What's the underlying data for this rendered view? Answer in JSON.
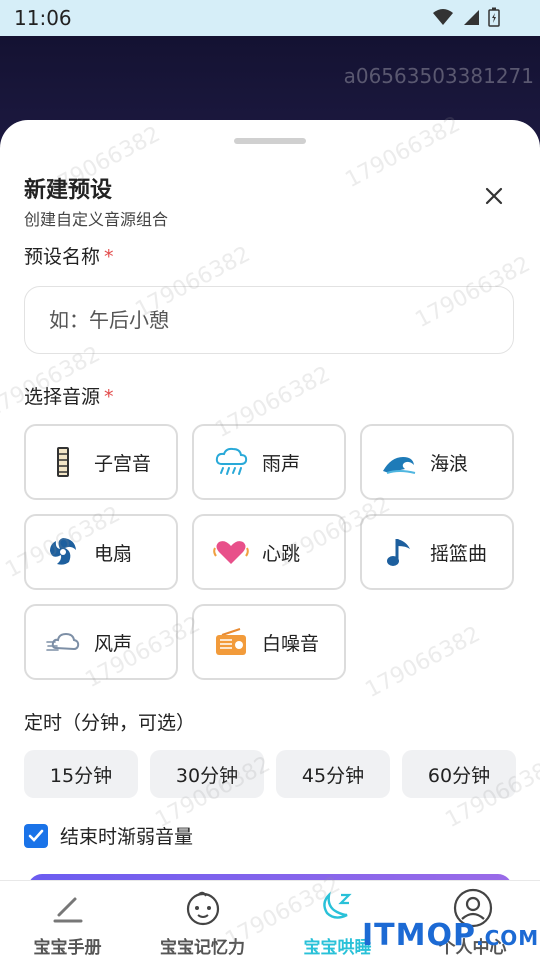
{
  "status_bar": {
    "time": "11:06"
  },
  "background": {
    "code_text": "a06563503381271"
  },
  "sheet": {
    "title": "新建预设",
    "subtitle": "创建自定义音源组合",
    "name_label": "预设名称",
    "required_mark": "*",
    "name_placeholder": "如：午后小憩",
    "sources_label": "选择音源",
    "sources": [
      {
        "label": "子宫音",
        "icon": "womb-sound-icon"
      },
      {
        "label": "雨声",
        "icon": "rain-cloud-icon"
      },
      {
        "label": "海浪",
        "icon": "ocean-wave-icon"
      },
      {
        "label": "电扇",
        "icon": "fan-icon"
      },
      {
        "label": "心跳",
        "icon": "heartbeat-icon"
      },
      {
        "label": "摇篮曲",
        "icon": "music-note-icon"
      },
      {
        "label": "风声",
        "icon": "wind-icon"
      },
      {
        "label": "白噪音",
        "icon": "radio-icon"
      }
    ],
    "timer_label": "定时（分钟，可选）",
    "timer_options": [
      "15分钟",
      "30分钟",
      "45分钟",
      "60分钟"
    ],
    "fade_label": "结束时渐弱音量",
    "fade_checked": true
  },
  "tabs": [
    {
      "label": "宝宝手册",
      "icon": "pen-icon",
      "active": false
    },
    {
      "label": "宝宝记忆力",
      "icon": "baby-face-icon",
      "active": false
    },
    {
      "label": "宝宝哄睡",
      "icon": "moon-sleep-icon",
      "active": true
    },
    {
      "label": "个人中心",
      "icon": "user-icon",
      "active": false
    }
  ],
  "watermark": {
    "text": "179066382"
  },
  "site_logo": {
    "text": "ITMOP",
    "suffix": ".COM"
  },
  "colors": {
    "accent": "#29c1d8",
    "checkbox": "#1a73e8",
    "required": "#e24a4a"
  }
}
